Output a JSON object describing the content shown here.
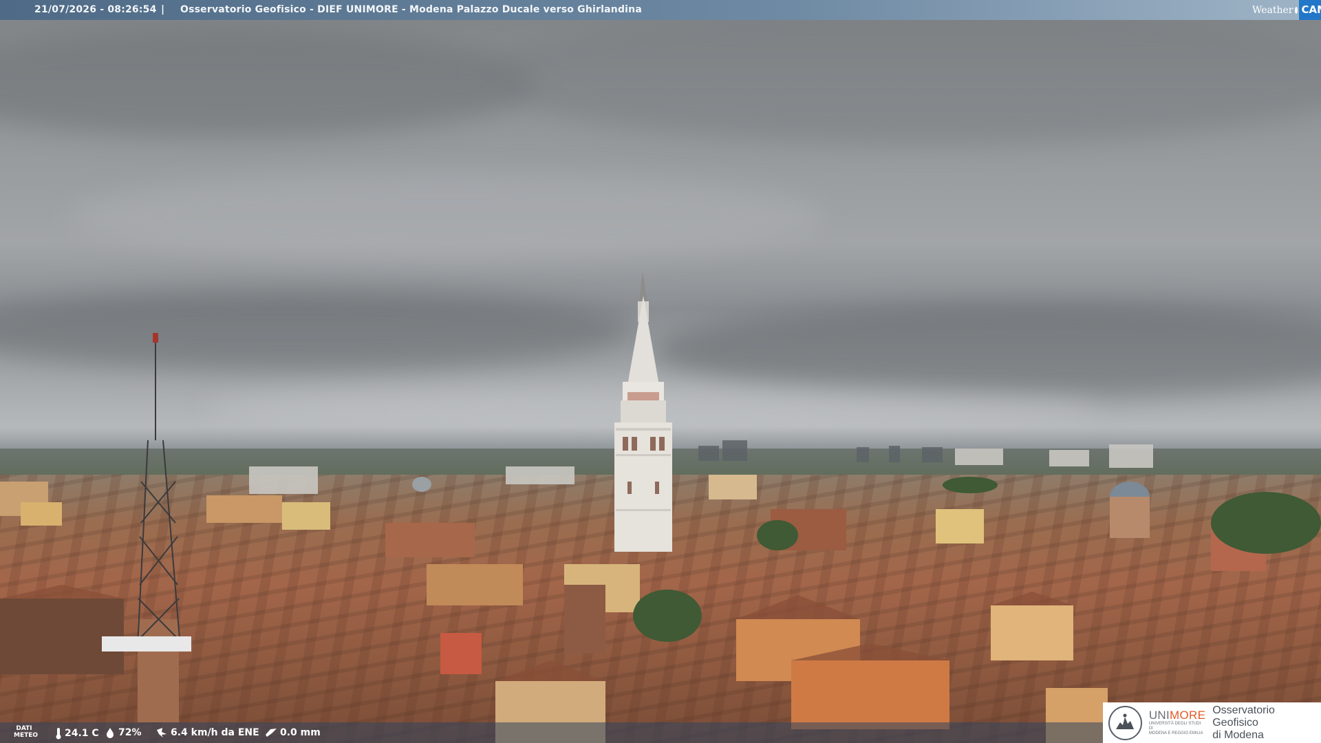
{
  "header": {
    "timestamp": "21/07/2026 - 08:26:54",
    "separator": "|",
    "location": "Osservatorio Geofisico - DIEF UNIMORE - Modena Palazzo Ducale verso Ghirlandina",
    "logo_weather": "Weather",
    "logo_cam": "CAM"
  },
  "weather": {
    "label": "DATI METEO",
    "temperature": "24.1 C",
    "humidity": "72%",
    "wind": "6.4 km/h da ENE",
    "rain": "0.0 mm"
  },
  "branding": {
    "university_accent": "MORE",
    "university_prefix": "UNI",
    "university_sub_1": "UNIVERSITÀ DEGLI STUDI DI",
    "university_sub_2": "MODENA E REGGIO EMILIA",
    "observatory_line_1": "Osservatorio Geofisico",
    "observatory_line_2": "di Modena"
  },
  "colors": {
    "header_bar": "#5f7b97",
    "unimore_accent": "#e05a28",
    "cam_blue": "#2277c9"
  },
  "icons": [
    "thermometer-icon",
    "humidity-drop-icon",
    "wind-icon",
    "rain-icon",
    "weathercam-logo",
    "unimore-seal-icon"
  ]
}
